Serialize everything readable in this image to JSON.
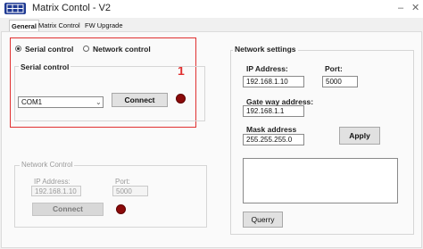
{
  "window": {
    "title": "Matrix Contol - V2",
    "minimize": "–",
    "close": "✕"
  },
  "tabs": [
    "General",
    "Matrix Control",
    "FW Upgrade"
  ],
  "mode": {
    "serial_label": "Serial control",
    "network_label": "Network control",
    "selected": "serial"
  },
  "serial": {
    "group_title": "Serial control",
    "port_value": "COM1",
    "connect_label": "Connect",
    "led_color": "#8b0a0a"
  },
  "annotation": {
    "marker": "1",
    "color": "#e03030"
  },
  "network_control": {
    "group_title": "Network Control",
    "ip_label": "IP Address:",
    "ip_value": "192.168.1.10",
    "port_label": "Port:",
    "port_value": "5000",
    "connect_label": "Connect",
    "led_color": "#8b0a0a"
  },
  "network_settings": {
    "group_title": "Network settings",
    "ip_label": "IP Address:",
    "ip_value": "192.168.1.10",
    "port_label": "Port:",
    "port_value": "5000",
    "gateway_label": "Gate way address:",
    "gateway_value": "192.168.1.1",
    "mask_label": "Mask address",
    "mask_value": "255.255.255.0",
    "apply_label": "Apply",
    "query_label": "Querry"
  }
}
